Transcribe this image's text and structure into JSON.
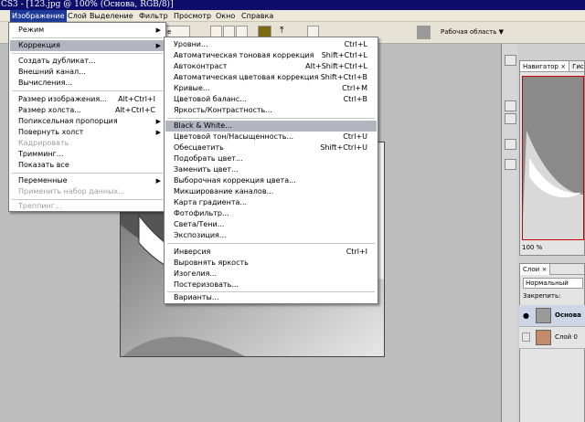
{
  "window": {
    "title": "CS3 - [123.jpg @ 100% (Основа, RGB/8)]"
  },
  "menubar": {
    "items": [
      "Изображение",
      "Слой",
      "Выделение",
      "Фильтр",
      "Просмотр",
      "Окно",
      "Справка"
    ],
    "active": "Изображение"
  },
  "options": {
    "mode_value": "ксе",
    "workspace_label": "Рабочая область ▼"
  },
  "image_menu": {
    "items": [
      {
        "label": "Режим",
        "arrow": "▶",
        "shortcut": ""
      },
      {
        "label": "Коррекция",
        "arrow": "▶",
        "shortcut": "",
        "highlight": true
      },
      {
        "label": "Создать дубликат...",
        "shortcut": ""
      },
      {
        "label": "Внешний канал...",
        "shortcut": ""
      },
      {
        "label": "Вычисления...",
        "shortcut": ""
      },
      {
        "label": "Размер изображения...",
        "shortcut": "Alt+Ctrl+I"
      },
      {
        "label": "Размер холста...",
        "shortcut": "Alt+Ctrl+C"
      },
      {
        "label": "Попиксельная пропорция",
        "arrow": "▶",
        "shortcut": ""
      },
      {
        "label": "Повернуть холст",
        "arrow": "▶",
        "shortcut": ""
      },
      {
        "label": "Кадрировать",
        "shortcut": "",
        "disabled": true
      },
      {
        "label": "Тримминг...",
        "shortcut": ""
      },
      {
        "label": "Показать все",
        "shortcut": ""
      },
      {
        "label": "Переменные",
        "arrow": "▶",
        "shortcut": ""
      },
      {
        "label": "Применить набор данных...",
        "shortcut": "",
        "disabled": true
      },
      {
        "label": "Треппинг...",
        "shortcut": "",
        "disabled": true
      }
    ]
  },
  "adjust_menu": {
    "items": [
      {
        "label": "Уровни...",
        "shortcut": "Ctrl+L"
      },
      {
        "label": "Автоматическая тоновая коррекция",
        "shortcut": "Shift+Ctrl+L"
      },
      {
        "label": "Автоконтраст",
        "shortcut": "Alt+Shift+Ctrl+L"
      },
      {
        "label": "Автоматическая цветовая коррекция",
        "shortcut": "Shift+Ctrl+B"
      },
      {
        "label": "Кривые...",
        "shortcut": "Ctrl+M"
      },
      {
        "label": "Цветовой баланс...",
        "shortcut": "Ctrl+B"
      },
      {
        "label": "Яркость/Контрастность...",
        "shortcut": ""
      },
      {
        "label": "Black & White...",
        "shortcut": "",
        "highlight": true
      },
      {
        "label": "Цветовой тон/Насыщенность...",
        "shortcut": "Ctrl+U"
      },
      {
        "label": "Обесцветить",
        "shortcut": "Shift+Ctrl+U"
      },
      {
        "label": "Подобрать цвет...",
        "shortcut": ""
      },
      {
        "label": "Заменить цвет...",
        "shortcut": ""
      },
      {
        "label": "Выборочная коррекция цвета...",
        "shortcut": ""
      },
      {
        "label": "Микширование каналов...",
        "shortcut": ""
      },
      {
        "label": "Карта градиента...",
        "shortcut": ""
      },
      {
        "label": "Фотофильтр...",
        "shortcut": ""
      },
      {
        "label": "Света/Тени...",
        "shortcut": ""
      },
      {
        "label": "Экспозиция...",
        "shortcut": ""
      },
      {
        "label": "Инверсия",
        "shortcut": "Ctrl+I"
      },
      {
        "label": "Выровнять яркость",
        "shortcut": ""
      },
      {
        "label": "Изогелия...",
        "shortcut": ""
      },
      {
        "label": "Постеризовать...",
        "shortcut": ""
      },
      {
        "label": "Варианты...",
        "shortcut": ""
      }
    ]
  },
  "navigator": {
    "tabs": [
      "Навигатор",
      "Гисто"
    ],
    "close": "×",
    "zoom": "100 %"
  },
  "layers": {
    "tab": "Слои",
    "close": "×",
    "blend_mode": "Нормальный",
    "lock_label": "Закрепить:",
    "items": [
      {
        "name": "Основа",
        "selected": true
      },
      {
        "name": "Слой 0",
        "selected": false
      }
    ]
  },
  "colors": {
    "accent": "#1d3a99",
    "highlight": "#b2b4bf",
    "title_bg": "#0d0d6b"
  }
}
